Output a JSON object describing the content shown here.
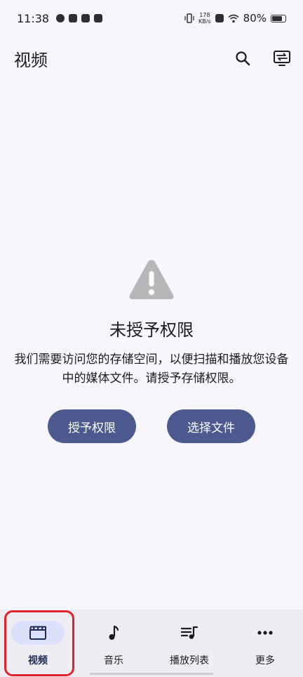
{
  "status_bar": {
    "time": "11:38",
    "net_speed_value": "178",
    "net_speed_unit": "KB/s",
    "battery": "80%",
    "battery_fraction": 0.8
  },
  "app_bar": {
    "title": "视频"
  },
  "empty_state": {
    "title": "未授予权限",
    "description": "我们需要访问您的存储空间，以便扫描和播放您设备中的媒体文件。请授予存储权限。",
    "primary_button": "授予权限",
    "secondary_button": "选择文件"
  },
  "bottom_nav": {
    "items": [
      {
        "label": "视频",
        "icon": "clapperboard-icon",
        "active": true
      },
      {
        "label": "音乐",
        "icon": "music-note-icon",
        "active": false
      },
      {
        "label": "播放列表",
        "icon": "playlist-icon",
        "active": false
      },
      {
        "label": "更多",
        "icon": "more-dots-icon",
        "active": false
      }
    ]
  },
  "colors": {
    "background": "#f8f6fd",
    "button": "#4c5a8f",
    "nav_background": "#efedf4",
    "nav_indicator": "#dbe0fb",
    "highlight": "#e0242b",
    "warning_icon": "#b7b7ba"
  }
}
